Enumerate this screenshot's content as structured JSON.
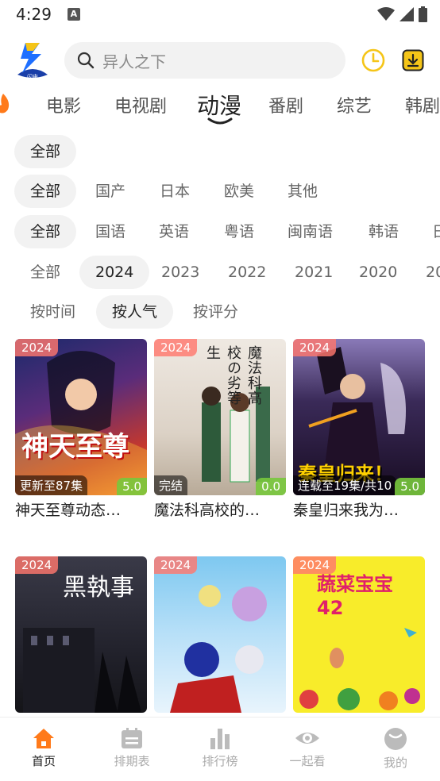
{
  "status_bar": {
    "time": "4:29",
    "badge": "A"
  },
  "header": {
    "logo_text": "闪电",
    "search_placeholder": "异人之下"
  },
  "categories": [
    "电影",
    "电视剧",
    "动漫",
    "番剧",
    "综艺",
    "韩剧"
  ],
  "active_category": "动漫",
  "filters": {
    "row1": [
      "全部"
    ],
    "row2": [
      "全部",
      "国产",
      "日本",
      "欧美",
      "其他"
    ],
    "row3": [
      "全部",
      "国语",
      "英语",
      "粤语",
      "闽南语",
      "韩语",
      "日"
    ],
    "row4": [
      "全部",
      "2024",
      "2023",
      "2022",
      "2021",
      "2020",
      "20"
    ],
    "row5": [
      "按时间",
      "按人气",
      "按评分"
    ]
  },
  "cards": [
    {
      "year": "2024",
      "status": "更新至87集",
      "score": "5.0",
      "title": "神天至尊动态…",
      "poster_text": "神天至尊"
    },
    {
      "year": "2024",
      "status": "完结",
      "score": "0.0",
      "title": "魔法科高校的…",
      "poster_text": "魔法科高校の劣等生"
    },
    {
      "year": "2024",
      "status": "连载至19集/共10",
      "score": "5.0",
      "title": "秦皇归来我为…",
      "poster_text": "秦皇归来！"
    },
    {
      "year": "2024",
      "status": "",
      "score": "",
      "title": "",
      "poster_text": "黑執事"
    },
    {
      "year": "2024",
      "status": "",
      "score": "",
      "title": "",
      "poster_text": ""
    },
    {
      "year": "2024",
      "status": "",
      "score": "",
      "title": "",
      "poster_text": "蔬菜宝宝 42"
    }
  ],
  "bottom_nav": [
    {
      "label": "首页",
      "active": true
    },
    {
      "label": "排期表",
      "active": false
    },
    {
      "label": "排行榜",
      "active": false
    },
    {
      "label": "一起看",
      "active": false
    },
    {
      "label": "我的",
      "active": false
    }
  ],
  "colors": {
    "accent": "#f5c518",
    "home_orange": "#ff7a1a",
    "score_green": "#78c83c",
    "year_badge": "#ff786e"
  }
}
